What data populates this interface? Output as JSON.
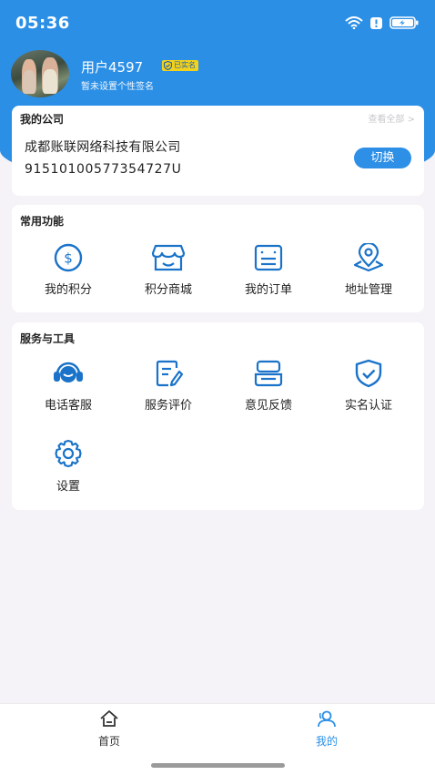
{
  "status_bar": {
    "time": "05:36"
  },
  "profile": {
    "username": "用户4597",
    "verified_label": "已实名",
    "signature": "暂未设置个性签名"
  },
  "company": {
    "section_title": "我的公司",
    "view_all": "查看全部 >",
    "name": "成都账联网络科技有限公司",
    "id": "91510100577354727U",
    "switch_label": "切换"
  },
  "common": {
    "section_title": "常用功能",
    "items": [
      {
        "label": "我的积分",
        "icon": "points-icon"
      },
      {
        "label": "积分商城",
        "icon": "store-icon"
      },
      {
        "label": "我的订单",
        "icon": "order-icon"
      },
      {
        "label": "地址管理",
        "icon": "location-icon"
      }
    ]
  },
  "tools": {
    "section_title": "服务与工具",
    "items": [
      {
        "label": "电话客服",
        "icon": "headset-icon"
      },
      {
        "label": "服务评价",
        "icon": "edit-icon"
      },
      {
        "label": "意见反馈",
        "icon": "feedback-icon"
      },
      {
        "label": "实名认证",
        "icon": "shield-check-icon"
      },
      {
        "label": "设置",
        "icon": "gear-icon"
      }
    ]
  },
  "tabbar": {
    "items": [
      {
        "label": "首页",
        "icon": "home-icon",
        "active": false
      },
      {
        "label": "我的",
        "icon": "profile-icon",
        "active": true
      }
    ]
  },
  "colors": {
    "brand_blue": "#2b8fe6",
    "accent_blue": "#1a73c9",
    "badge_yellow": "#f4d21a",
    "background": "#f5f3f7"
  }
}
